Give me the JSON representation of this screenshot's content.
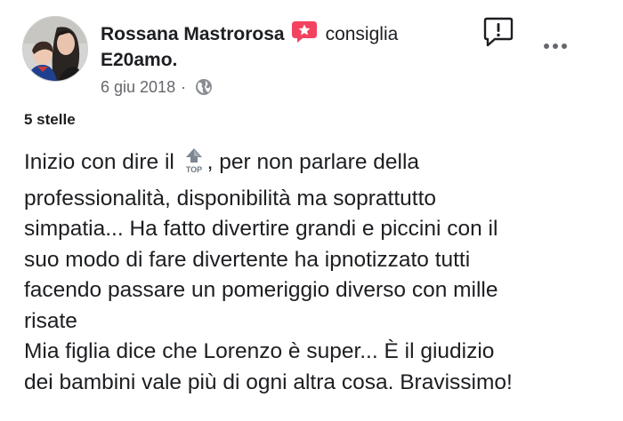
{
  "post": {
    "author": "Rossana Mastrorosa",
    "verb": "consiglia",
    "page": "E20amo.",
    "date": "6 giu 2018",
    "separator": "·",
    "privacy_icon": "globe-icon",
    "recommend_icon": "recommend-badge-icon",
    "report_icon": "report-icon",
    "more_icon": "more-icon",
    "rating": "5 stelle",
    "emoji": "top-emoji",
    "review_lines": [
      {
        "before": "Inizio con dire il ",
        "after": ", per non parlare della"
      },
      {
        "text": "professionalità, disponibilità ma soprattutto"
      },
      {
        "text": "simpatia... Ha fatto divertire grandi e piccini con il"
      },
      {
        "text": "suo modo di fare divertente ha ipnotizzato tutti"
      },
      {
        "text": "facendo passare un pomeriggio diverso con mille"
      },
      {
        "text": "risate"
      },
      {
        "text": "Mia figlia dice che Lorenzo è super... È il giudizio"
      },
      {
        "text": "dei bambini vale più di ogni altra cosa. Bravissimo!"
      }
    ],
    "colors": {
      "text": "#1c1e21",
      "secondary": "#65676b",
      "recommend": "#f3425f"
    }
  }
}
